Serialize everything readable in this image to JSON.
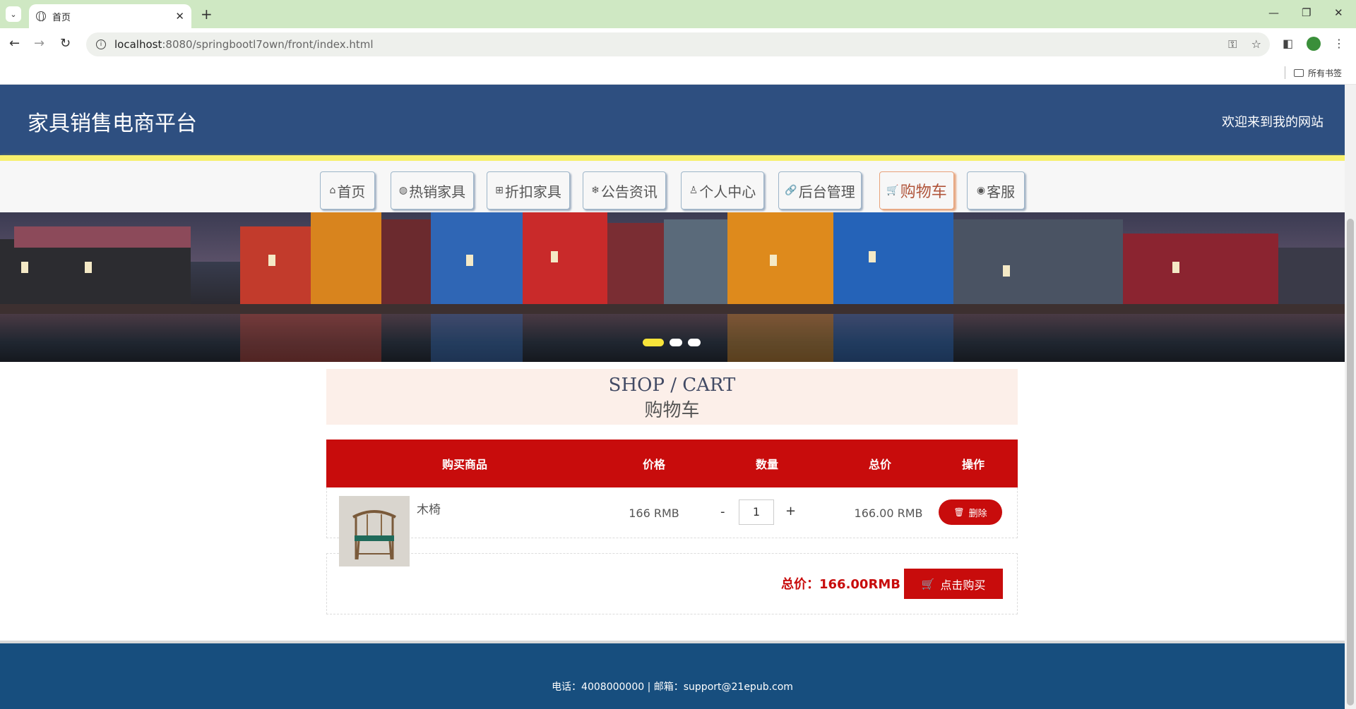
{
  "browser": {
    "tab_title": "首页",
    "url_host": "localhost",
    "url_path": ":8080/springbootl7own/front/index.html",
    "bookmarks_all": "所有书签"
  },
  "site": {
    "title": "家具销售电商平台",
    "welcome": "欢迎来到我的网站"
  },
  "nav": [
    {
      "label": "首页",
      "icon": "home-icon",
      "glyph": "⌂"
    },
    {
      "label": "热销家具",
      "icon": "globe-icon",
      "glyph": "◍"
    },
    {
      "label": "折扣家具",
      "icon": "gift-icon",
      "glyph": "⊞"
    },
    {
      "label": "公告资讯",
      "icon": "snowflake-icon",
      "glyph": "❄"
    },
    {
      "label": "个人中心",
      "icon": "user-icon",
      "glyph": "♙"
    },
    {
      "label": "后台管理",
      "icon": "link-icon",
      "glyph": "🔗"
    },
    {
      "label": "购物车",
      "icon": "cart-icon",
      "glyph": "🛒"
    },
    {
      "label": "客服",
      "icon": "chat-icon",
      "glyph": "◉"
    }
  ],
  "carousel": {
    "active_index": 0,
    "count": 3
  },
  "shop_header": {
    "en": "SHOP / CART",
    "zh": "购物车"
  },
  "table": {
    "headers": [
      "购买商品",
      "价格",
      "数量",
      "总价",
      "操作"
    ],
    "rows": [
      {
        "name": "木椅",
        "price": "166 RMB",
        "qty": "1",
        "subtotal": "166.00 RMB",
        "delete": "删除",
        "minus": "-",
        "plus": "+"
      }
    ]
  },
  "total": {
    "label": "总价：166.00RMB",
    "buy": "点击购买"
  },
  "footer": {
    "text": "电话：4008000000 | 邮箱：support@21epub.com"
  },
  "colors": {
    "header": "#2e4f80",
    "accent": "#c80c0c",
    "footer": "#174e7e",
    "active_nav": "#b0543a"
  }
}
